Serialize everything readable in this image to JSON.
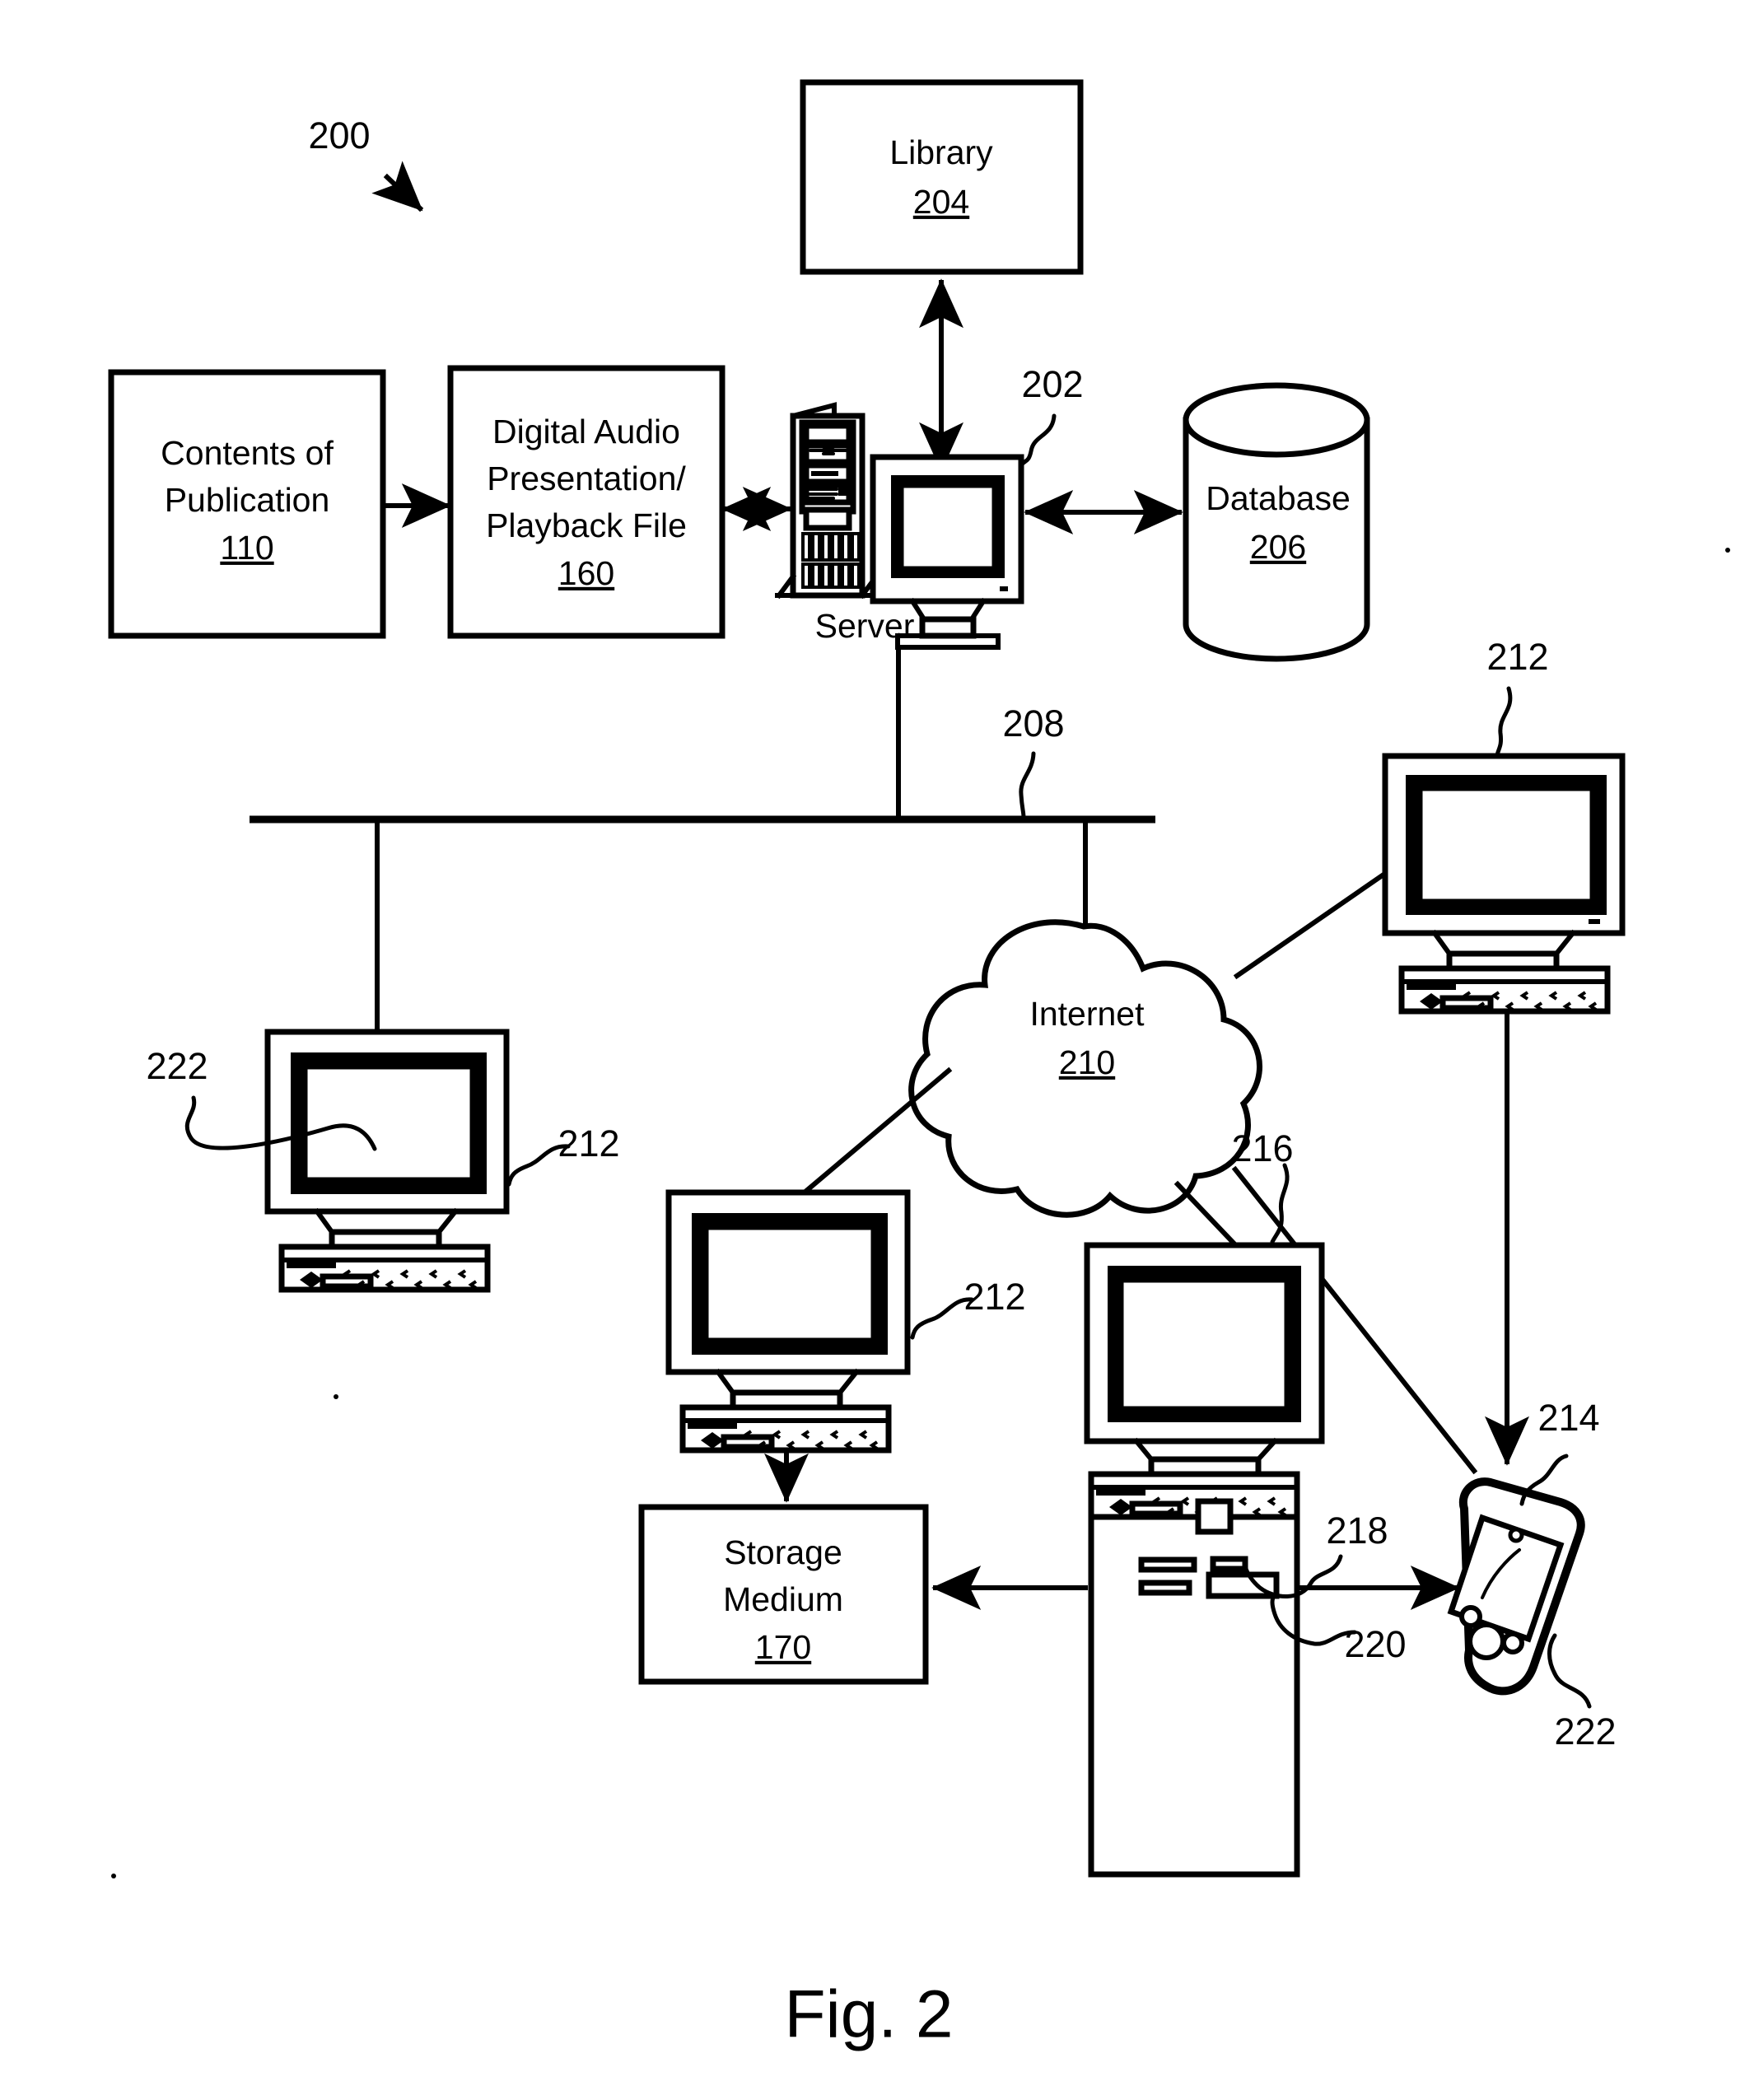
{
  "figure": {
    "caption": "Fig. 2",
    "system_ref": "200"
  },
  "nodes": {
    "contents_of_publication": {
      "line1": "Contents of",
      "line2": "Publication",
      "ref": "110"
    },
    "digital_audio_file": {
      "line1": "Digital Audio",
      "line2": "Presentation/",
      "line3": "Playback File",
      "ref": "160"
    },
    "library": {
      "line1": "Library",
      "ref": "204"
    },
    "database": {
      "line1": "Database",
      "ref": "206"
    },
    "internet": {
      "line1": "Internet",
      "ref": "210"
    },
    "storage_medium": {
      "line1": "Storage",
      "line2": "Medium",
      "ref": "170"
    },
    "server": {
      "caption": "Server",
      "ref": "202"
    }
  },
  "callouts": {
    "system": "200",
    "server_computer": "202",
    "network_bus": "208",
    "client_top_right": "212",
    "client_left": "212",
    "client_middle": "212",
    "client_left_display": "222",
    "computer_216": "216",
    "tower_drive_218": "218",
    "tower_drive_220": "220",
    "handheld_214": "214",
    "handheld_display_222": "222"
  }
}
